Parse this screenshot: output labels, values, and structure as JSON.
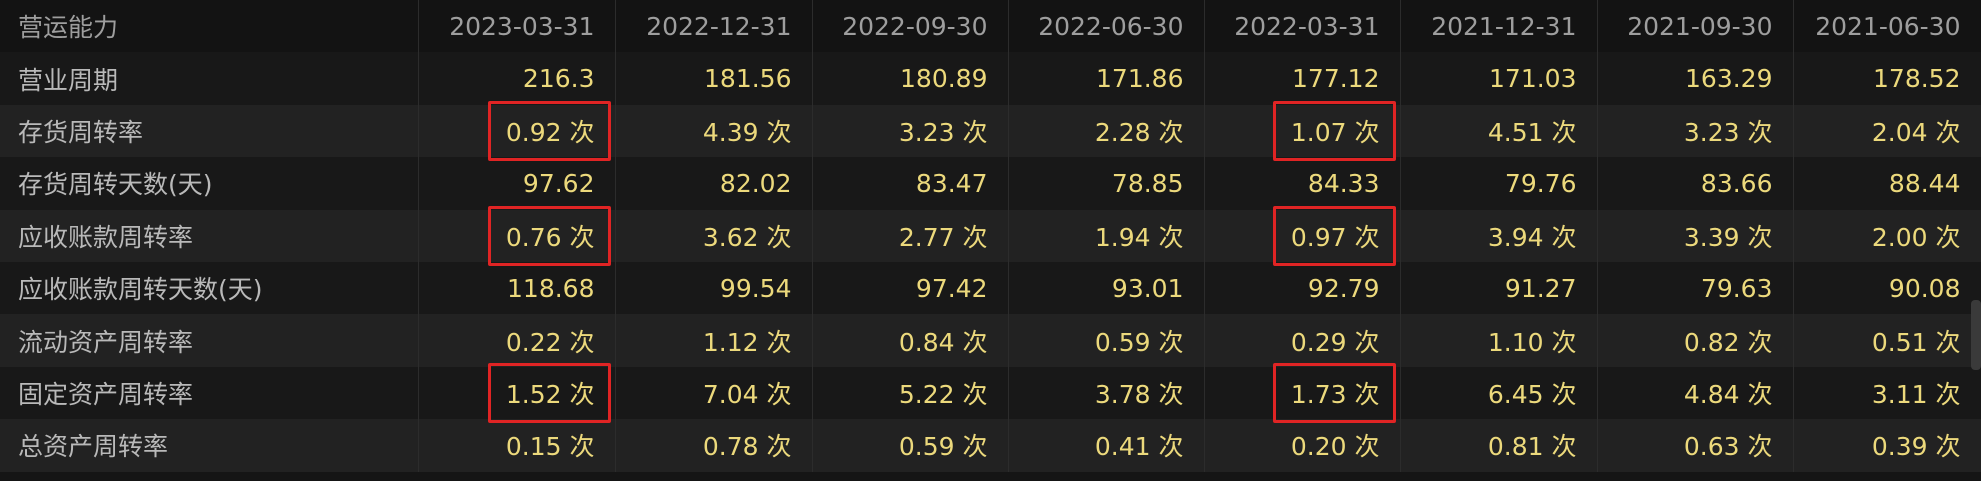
{
  "table": {
    "header": [
      "营运能力",
      "2023-03-31",
      "2022-12-31",
      "2022-09-30",
      "2022-06-30",
      "2022-03-31",
      "2021-12-31",
      "2021-09-30",
      "2021-06-30"
    ],
    "rows": [
      {
        "label": "营业周期",
        "values": [
          "216.3",
          "181.56",
          "180.89",
          "171.86",
          "177.12",
          "171.03",
          "163.29",
          "178.52"
        ]
      },
      {
        "label": "存货周转率",
        "values": [
          "0.92 次",
          "4.39 次",
          "3.23 次",
          "2.28 次",
          "1.07 次",
          "4.51 次",
          "3.23 次",
          "2.04 次"
        ]
      },
      {
        "label": "存货周转天数(天)",
        "values": [
          "97.62",
          "82.02",
          "83.47",
          "78.85",
          "84.33",
          "79.76",
          "83.66",
          "88.44"
        ]
      },
      {
        "label": "应收账款周转率",
        "values": [
          "0.76 次",
          "3.62 次",
          "2.77 次",
          "1.94 次",
          "0.97 次",
          "3.94 次",
          "3.39 次",
          "2.00 次"
        ]
      },
      {
        "label": "应收账款周转天数(天)",
        "values": [
          "118.68",
          "99.54",
          "97.42",
          "93.01",
          "92.79",
          "91.27",
          "79.63",
          "90.08"
        ]
      },
      {
        "label": "流动资产周转率",
        "values": [
          "0.22 次",
          "1.12 次",
          "0.84 次",
          "0.59 次",
          "0.29 次",
          "1.10 次",
          "0.82 次",
          "0.51 次"
        ]
      },
      {
        "label": "固定资产周转率",
        "values": [
          "1.52 次",
          "7.04 次",
          "5.22 次",
          "3.78 次",
          "1.73 次",
          "6.45 次",
          "4.84 次",
          "3.11 次"
        ]
      },
      {
        "label": "总资产周转率",
        "values": [
          "0.15 次",
          "0.78 次",
          "0.59 次",
          "0.41 次",
          "0.20 次",
          "0.81 次",
          "0.63 次",
          "0.39 次"
        ]
      }
    ]
  },
  "highlight_color": "#e02424"
}
